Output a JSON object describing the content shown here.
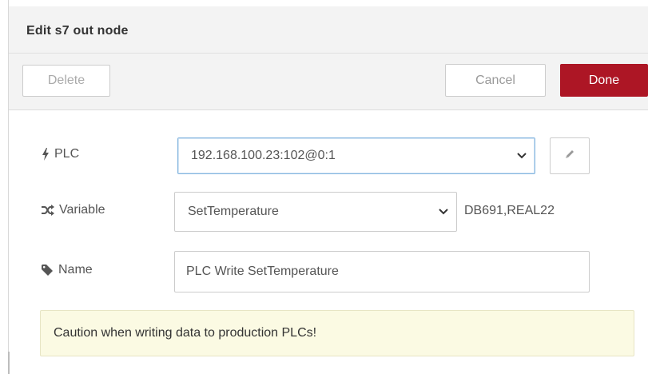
{
  "dialog": {
    "title": "Edit s7 out node"
  },
  "toolbar": {
    "delete_label": "Delete",
    "cancel_label": "Cancel",
    "done_label": "Done",
    "done_color": "#ad1625"
  },
  "form": {
    "plc": {
      "label": "PLC",
      "icon": "bolt-icon",
      "selected_value": "192.168.100.23:102@0:1",
      "edit_icon": "pencil-icon"
    },
    "variable": {
      "label": "Variable",
      "icon": "random-icon",
      "selected_value": "SetTemperature",
      "address": "DB691,REAL22"
    },
    "name": {
      "label": "Name",
      "icon": "tag-icon",
      "value": "PLC Write SetTemperature"
    }
  },
  "caution": {
    "text": "Caution when writing data to production PLCs!"
  }
}
